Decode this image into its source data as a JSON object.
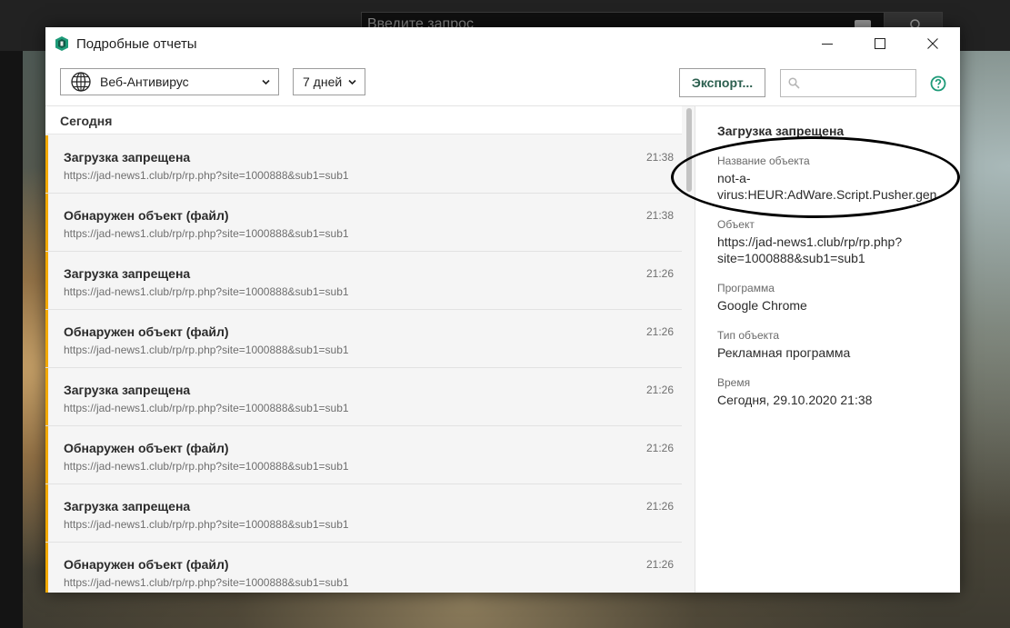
{
  "background": {
    "search_placeholder": "Введите запрос"
  },
  "window": {
    "title": "Подробные отчеты",
    "accent_color": "#f2a900",
    "brand_color": "#2c5f4f"
  },
  "toolbar": {
    "component_select": {
      "value": "Веб-Антивирус",
      "icon": "globe-icon"
    },
    "period_select": {
      "value": "7 дней"
    },
    "export_label": "Экспорт...",
    "search": {
      "value": "",
      "placeholder": ""
    }
  },
  "list": {
    "section_label": "Сегодня",
    "events": [
      {
        "title": "Загрузка запрещена",
        "url": "https://jad-news1.club/rp/rp.php?site=1000888&sub1=sub1",
        "time": "21:38"
      },
      {
        "title": "Обнаружен объект (файл)",
        "url": "https://jad-news1.club/rp/rp.php?site=1000888&sub1=sub1",
        "time": "21:38"
      },
      {
        "title": "Загрузка запрещена",
        "url": "https://jad-news1.club/rp/rp.php?site=1000888&sub1=sub1",
        "time": "21:26"
      },
      {
        "title": "Обнаружен объект (файл)",
        "url": "https://jad-news1.club/rp/rp.php?site=1000888&sub1=sub1",
        "time": "21:26"
      },
      {
        "title": "Загрузка запрещена",
        "url": "https://jad-news1.club/rp/rp.php?site=1000888&sub1=sub1",
        "time": "21:26"
      },
      {
        "title": "Обнаружен объект (файл)",
        "url": "https://jad-news1.club/rp/rp.php?site=1000888&sub1=sub1",
        "time": "21:26"
      },
      {
        "title": "Загрузка запрещена",
        "url": "https://jad-news1.club/rp/rp.php?site=1000888&sub1=sub1",
        "time": "21:26"
      },
      {
        "title": "Обнаружен объект (файл)",
        "url": "https://jad-news1.club/rp/rp.php?site=1000888&sub1=sub1",
        "time": "21:26"
      }
    ]
  },
  "details": {
    "title": "Загрузка запрещена",
    "fields": [
      {
        "label": "Название объекта",
        "value": "not-a-virus:HEUR:AdWare.Script.Pusher.gen"
      },
      {
        "label": "Объект",
        "value": "https://jad-news1.club/rp/rp.php?site=1000888&sub1=sub1"
      },
      {
        "label": "Программа",
        "value": "Google Chrome"
      },
      {
        "label": "Тип объекта",
        "value": "Рекламная программа"
      },
      {
        "label": "Время",
        "value": "Сегодня, 29.10.2020 21:38"
      }
    ]
  }
}
